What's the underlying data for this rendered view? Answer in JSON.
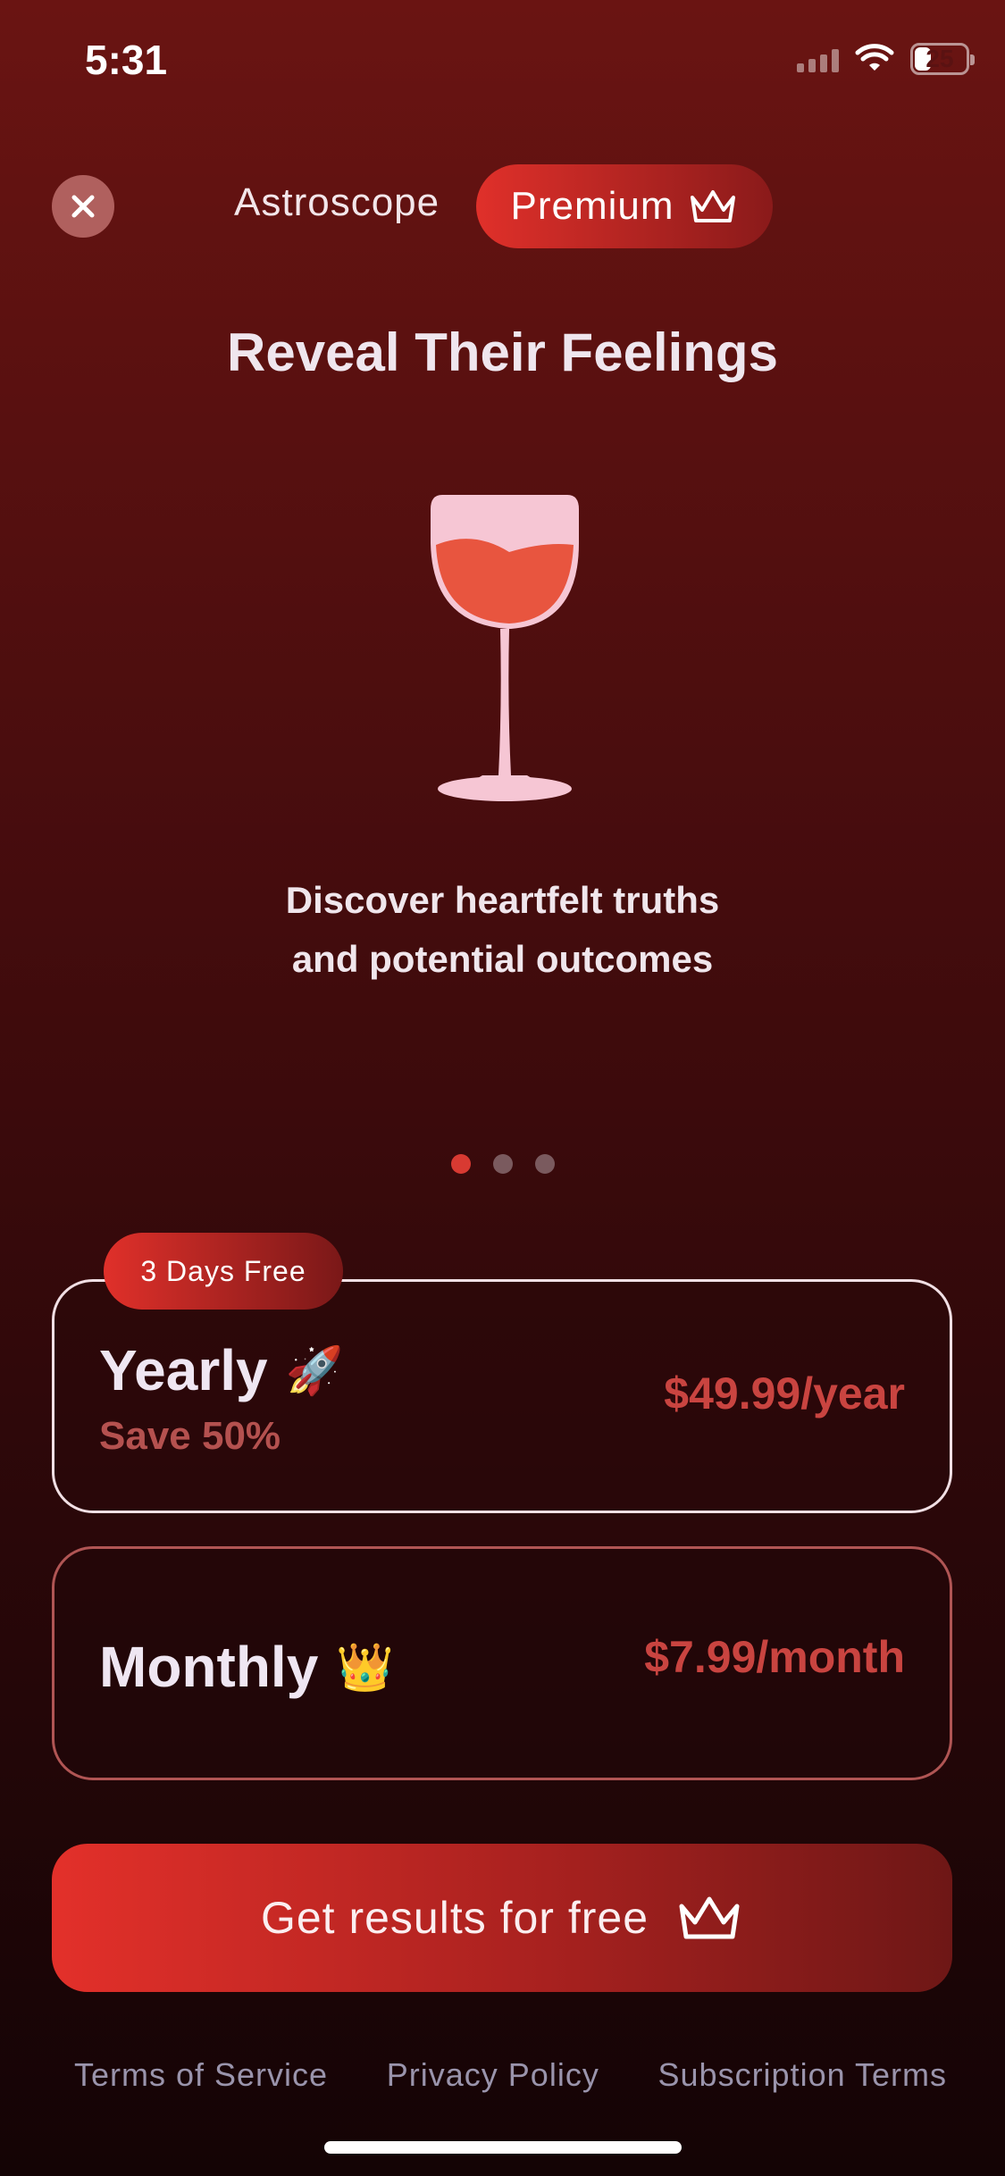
{
  "status_bar": {
    "time": "5:31",
    "battery_level": "25"
  },
  "header": {
    "brand": "Astroscope",
    "premium_label": "Premium"
  },
  "hero": {
    "title": "Reveal Their Feelings",
    "subtitle_line1": "Discover heartfelt truths",
    "subtitle_line2": "and potential outcomes",
    "page_count": 3,
    "active_page": 1
  },
  "plans": {
    "badge": "3 Days Free",
    "yearly": {
      "name": "Yearly",
      "emoji": "🚀",
      "save": "Save 50%",
      "price": "$49.99/year",
      "selected": true
    },
    "monthly": {
      "name": "Monthly",
      "emoji": "👑",
      "price": "$7.99/month",
      "selected": false
    }
  },
  "cta": {
    "label": "Get results for free"
  },
  "footer": {
    "terms": "Terms of Service",
    "privacy": "Privacy Policy",
    "subscription": "Subscription Terms"
  },
  "colors": {
    "accent": "#e0302a",
    "price": "#c94440",
    "background_top": "#6a1412",
    "background_bottom": "#140405"
  }
}
